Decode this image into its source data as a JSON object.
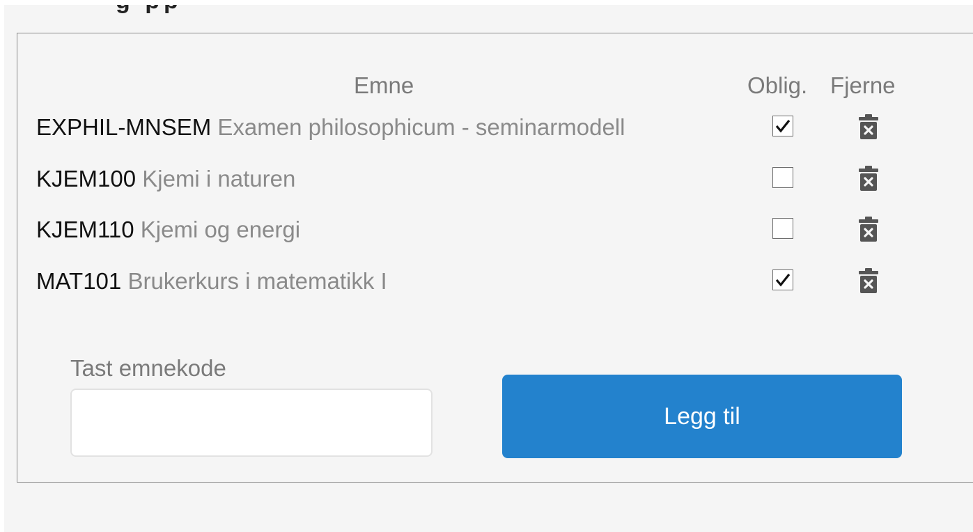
{
  "section": {
    "cut_heading": "g pp"
  },
  "table": {
    "headers": {
      "emne": "Emne",
      "oblig": "Oblig.",
      "fjerne": "Fjerne"
    },
    "rows": [
      {
        "code": "EXPHIL-MNSEM",
        "name": "Examen philosophicum - seminarmodell",
        "obligatory": true
      },
      {
        "code": "KJEM100",
        "name": "Kjemi i naturen",
        "obligatory": false
      },
      {
        "code": "KJEM110",
        "name": "Kjemi og energi",
        "obligatory": false
      },
      {
        "code": "MAT101",
        "name": "Brukerkurs i matematikk I",
        "obligatory": true
      }
    ]
  },
  "form": {
    "input_label": "Tast emnekode",
    "input_value": "",
    "add_button_label": "Legg til"
  },
  "icons": {
    "remove": "trash-icon",
    "check": "checkmark-icon"
  },
  "colors": {
    "accent": "#2382cd",
    "background": "#f5f5f5",
    "muted_text": "#8a8a8a",
    "icon": "#555555"
  }
}
